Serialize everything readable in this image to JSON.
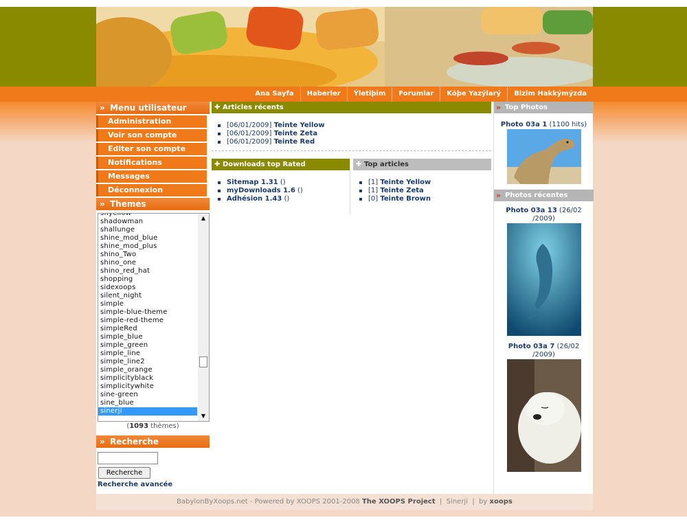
{
  "nav": [
    "Ana Sayfa",
    "Haberler",
    "Ýletiþim",
    "Forumlar",
    "Köþe Yazýlarý",
    "Bizim Hakkýmýzda"
  ],
  "user_menu": {
    "title": "Menu utilisateur",
    "items": [
      "Administration",
      "Voir son compte",
      "Editer son compte",
      "Notifications",
      "Messages",
      "Déconnexion"
    ]
  },
  "themes": {
    "title": "Themes",
    "items": [
      "sfiyellow",
      "shadowman",
      "shallunge",
      "shine_mod_blue",
      "shine_mod_plus",
      "shino_Two",
      "shino_one",
      "shino_red_hat",
      "shopping",
      "sidexoops",
      "silent_night",
      "simple",
      "simple-blue-theme",
      "simple-red-theme",
      "simpleRed",
      "simple_blue",
      "simple_green",
      "simple_line",
      "simple_line2",
      "simple_orange",
      "simplicityblack",
      "simplicitywhite",
      "sine-green",
      "sine_blue",
      "sinerji"
    ],
    "selected": "sinerji",
    "count_prefix": "(",
    "count": "1093",
    "count_suffix": " thèmes)"
  },
  "search": {
    "title": "Recherche",
    "button": "Recherche",
    "advanced": "Recherche avancée",
    "value": ""
  },
  "recent_articles": {
    "title": "Articles récents",
    "items": [
      {
        "date": "[06/01/2009]",
        "title": "Teinte Yellow"
      },
      {
        "date": "[06/01/2009]",
        "title": "Teinte Zeta"
      },
      {
        "date": "[06/01/2009]",
        "title": "Teinte Red"
      }
    ]
  },
  "downloads": {
    "title": "Downloads top Rated",
    "items": [
      {
        "name": "Sitemap 1.31",
        "extra": " ()"
      },
      {
        "name": "myDownloads 1.6",
        "extra": " ()"
      },
      {
        "name": "Adhésion 1.43",
        "extra": " ()"
      }
    ]
  },
  "top_articles": {
    "title": "Top articles",
    "items": [
      {
        "count": "[1]",
        "title": "Teinte Yellow"
      },
      {
        "count": "[1]",
        "title": "Teinte Zeta"
      },
      {
        "count": "[0]",
        "title": "Teinte Brown"
      }
    ]
  },
  "top_photos": {
    "title": "Top Photos",
    "photo": {
      "name": "Photo 03a 1",
      "hits": " (1100 hits)"
    }
  },
  "recent_photos": {
    "title": "Photos récentes",
    "photos": [
      {
        "name": "Photo 03a 13",
        "date_line1": " (26/02",
        "date_line2": "/2009)"
      },
      {
        "name": "Photo 03a 7",
        "date_line1": " (26/02",
        "date_line2": "/2009)"
      }
    ]
  },
  "footer": {
    "site": "BabylonByXoops.net",
    "powered": " - Powered by XOOPS 2001-2008 ",
    "project": "The XOOPS Project",
    "sep1": "  |  ",
    "theme": "Sinerji",
    "sep2": "  |  by ",
    "author": "xoops"
  },
  "colors": {
    "accent": "#f07a1a",
    "olive": "#8a8a00",
    "link": "#1b3b6b",
    "selection": "#3399ff"
  }
}
